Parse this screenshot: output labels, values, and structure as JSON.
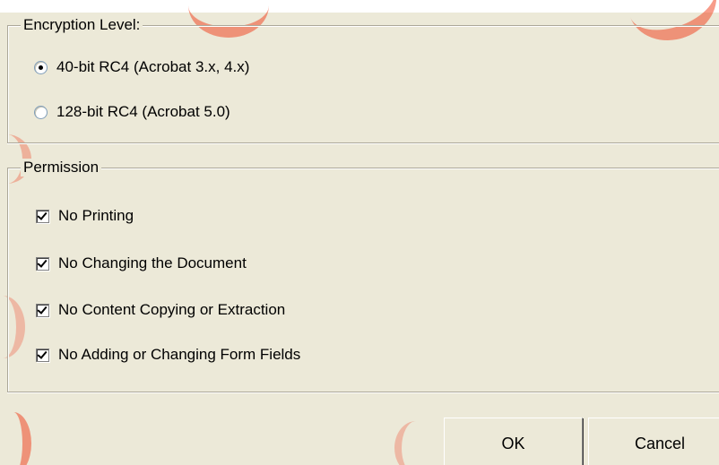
{
  "encryption": {
    "legend": "Encryption Level:",
    "options": [
      {
        "label": "40-bit RC4 (Acrobat 3.x, 4.x)",
        "checked": true
      },
      {
        "label": "128-bit RC4 (Acrobat 5.0)",
        "checked": false
      }
    ]
  },
  "permission": {
    "legend": "Permission",
    "options": [
      {
        "label": "No Printing",
        "checked": true
      },
      {
        "label": "No Changing the Document",
        "checked": true
      },
      {
        "label": "No Content Copying or Extraction",
        "checked": true
      },
      {
        "label": "No Adding or Changing Form Fields",
        "checked": true
      }
    ]
  },
  "buttons": {
    "ok_label": "OK",
    "cancel_label": "Cancel"
  },
  "colors": {
    "dialog_background": "#ece9d8",
    "brand_accent": "#f04a2a"
  }
}
